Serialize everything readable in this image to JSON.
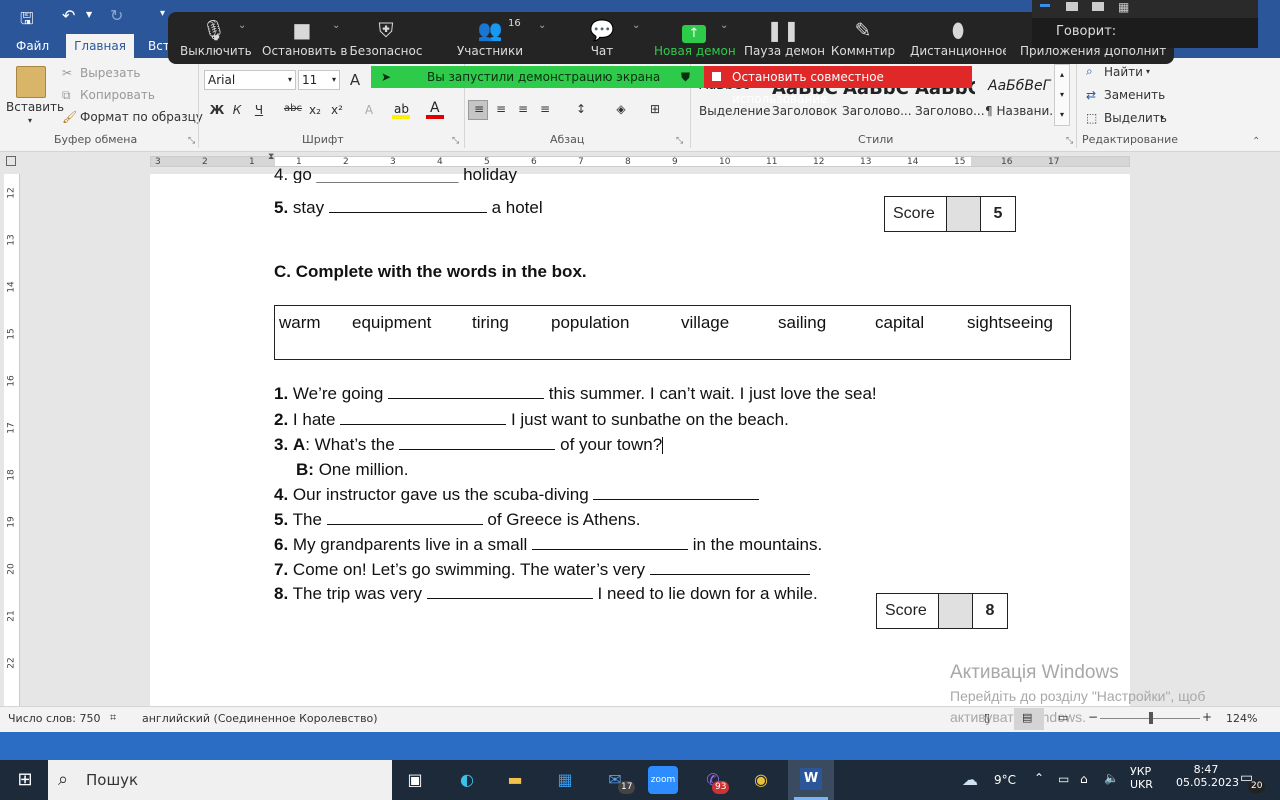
{
  "ribbon_tabs": {
    "file": "Файл",
    "home": "Главная",
    "insert_partial": "Вст"
  },
  "clipboard": {
    "paste": "Вставить",
    "cut": "Вырезать",
    "copy": "Копировать",
    "format_painter": "Формат по образцу",
    "group": "Буфер обмена"
  },
  "font": {
    "name": "Arial",
    "size": "11",
    "group": "Шрифт",
    "bold": "Ж",
    "italic": "К",
    "underline": "Ч",
    "strike": "abc",
    "sub": "x₂",
    "sup": "x²",
    "grow": "A",
    "clear": "A"
  },
  "paragraph": {
    "group": "Абзац"
  },
  "styles": {
    "group": "Стили",
    "items": [
      {
        "preview": "AaBbCc",
        "label": "Выделение"
      },
      {
        "preview": "AaBbC",
        "label": "Заголовок"
      },
      {
        "preview": "AaBbC",
        "label": "Заголово..."
      },
      {
        "preview": "AaBbC",
        "label": "Заголово..."
      },
      {
        "preview": "АаБбВеГ",
        "label": "¶ Названи..."
      }
    ]
  },
  "editing": {
    "group": "Редактирование",
    "find": "Найти",
    "replace": "Заменить",
    "select": "Выделить"
  },
  "zoom": {
    "mute": "Выключить",
    "video": "Остановить в",
    "security": "Безопаснос",
    "participants": "Участники",
    "participants_count": "16",
    "chat": "Чат",
    "new_share": "Новая демон",
    "pause_share": "Пауза демон",
    "annotate": "Коммнтир",
    "remote": "Дистанционное у",
    "apps": "Приложения",
    "more": "Дополнит",
    "sharing_notice": "Вы запустили демонстрацию экрана",
    "stop_share": "Остановить совместное использование",
    "speaking": "Говорит:"
  },
  "ruler": {
    "h_numbers": [
      "3",
      "2",
      "1",
      "1",
      "2",
      "3",
      "4",
      "5",
      "6",
      "7",
      "8",
      "9",
      "10",
      "11",
      "12",
      "13",
      "14",
      "15",
      "16",
      "17"
    ],
    "v_numbers": [
      "12",
      "13",
      "14",
      "15",
      "16",
      "17",
      "18",
      "19",
      "20",
      "21",
      "22"
    ]
  },
  "doc": {
    "line_partial": "4. go _______________ holiday",
    "item5_num": "5.",
    "item5_a": "stay",
    "item5_b": "a hotel",
    "score_label": "Score",
    "score1_value": "5",
    "section_c": "C. Complete with the words in the box.",
    "words": [
      "warm",
      "equipment",
      "tiring",
      "population",
      "village",
      "sailing",
      "capital",
      "sightseeing"
    ],
    "items": [
      {
        "num": "1.",
        "pre": "We’re going",
        "post": "this summer. I can’t wait. I just love the sea!"
      },
      {
        "num": "2.",
        "pre": "I hate",
        "post": "I just want to sunbathe on the beach."
      },
      {
        "num": "3.",
        "speaker": "A",
        "pre": ": What’s the",
        "post": "of your town?"
      },
      {
        "num": "",
        "speaker": "B:",
        "pre": "One million.",
        "post": ""
      },
      {
        "num": "4.",
        "pre": "Our instructor gave us the scuba-diving",
        "post": ""
      },
      {
        "num": "5.",
        "pre": "The",
        "post": "of Greece is Athens."
      },
      {
        "num": "6.",
        "pre": "My grandparents live in a small",
        "post": "in the mountains."
      },
      {
        "num": "7.",
        "pre": "Come on! Let’s go swimming. The water’s very",
        "post": ""
      },
      {
        "num": "8.",
        "pre": "The trip was very",
        "post": "I need to lie down for a while."
      }
    ],
    "score2_value": "8"
  },
  "watermark": {
    "title": "Активація Windows",
    "line1": "Перейдіть до розділу \"Настройки\", щоб",
    "line2": "активувати Windows."
  },
  "status": {
    "words": "Число слов: 750",
    "language": "английский (Соединенное Королевство)",
    "zoom": "124%"
  },
  "taskbar": {
    "search": "Пошук",
    "mail_badge": "17",
    "viber_badge": "93",
    "weather": "9°C",
    "lang1": "УКР",
    "lang2": "UKR",
    "time": "8:47",
    "date": "05.05.2023",
    "notif": "20"
  },
  "colors": {
    "word_blue": "#2b579a",
    "zoom_green": "#2ecb4a",
    "zoom_red": "#e02828"
  }
}
